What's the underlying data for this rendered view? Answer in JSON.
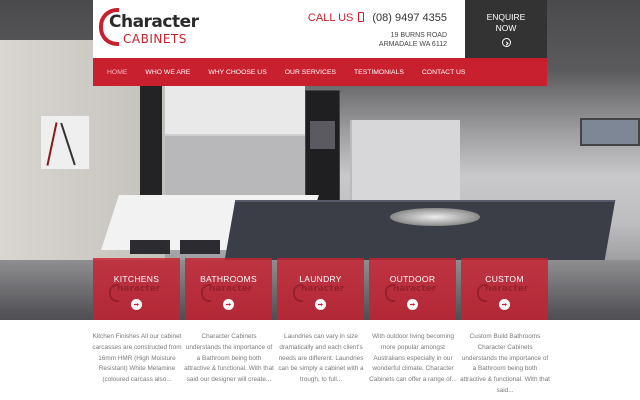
{
  "brand": {
    "logo_line1": "Character",
    "logo_line2": "CABINETS",
    "accent_color": "#c8202f",
    "dark_color": "#333333"
  },
  "contact": {
    "call_label": "CALL US",
    "phone": "(08) 9497 4355",
    "address_line1": "19 BURNS ROAD",
    "address_line2": "ARMADALE WA 6112"
  },
  "enquire": {
    "line1": "ENQUIRE",
    "line2": "NOW",
    "icon": "arrow-right-circle-icon"
  },
  "nav": {
    "items": [
      {
        "label": "HOME",
        "active": true
      },
      {
        "label": "WHO WE ARE"
      },
      {
        "label": "WHY CHOOSE US"
      },
      {
        "label": "OUR SERVICES"
      },
      {
        "label": "TESTIMONIALS"
      },
      {
        "label": "CONTACT US"
      }
    ]
  },
  "services": [
    {
      "title": "KITCHENS",
      "desc": "Kitchen Finishes All our cabinet carcasses are constructed from 16mm HMR (High Moisture Resistant) White Melamine (coloured carcass also..."
    },
    {
      "title": "BATHROOMS",
      "desc": "Character Cabinets understands the importance of a Bathroom being both attractive & functional. With that said our designer will create..."
    },
    {
      "title": "LAUNDRY",
      "desc": "Laundries can vary in size dramatically and each client's needs are different. Laundries can be simply a cabinet with a trough, to full..."
    },
    {
      "title": "OUTDOOR",
      "desc": "With outdoor living becoming more popular amongst Australians especially in our wonderful climate, Character Cabinets can offer a range of..."
    },
    {
      "title": "CUSTOM",
      "desc": "Custom Build Bathrooms Character Cabinets understands the importance of a Bathroom being both attractive & functional. With that said..."
    }
  ],
  "tile_watermark": "haracter"
}
